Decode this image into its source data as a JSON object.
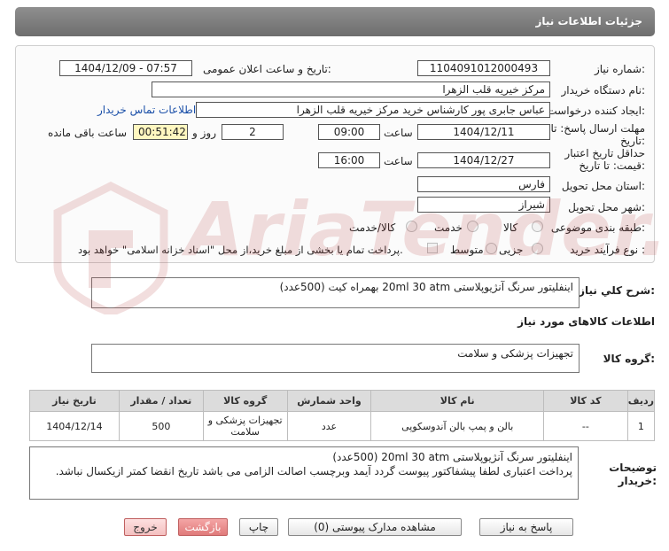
{
  "header": {
    "title": "جزئیات اطلاعات نیاز"
  },
  "form": {
    "need_number_label": "شماره نیاز:",
    "need_number": "1104091012000493",
    "announce_label": "تاریخ و ساعت اعلان عمومی:",
    "announce_value": "1404/12/09 - 07:57",
    "buyer_org_label": "نام دستگاه خریدار:",
    "buyer_org": "مرکز خیریه قلب الزهرا",
    "creator_label": "ایجاد کننده درخواست:",
    "creator": "عباس جابری پور کارشناس خرید مرکز خیریه قلب الزهرا",
    "contact_link": "اطلاعات تماس خریدار",
    "deadline_label_1": "مهلت ارسال پاسخ: تا",
    "deadline_label_2": "تاریخ:",
    "deadline_date": "1404/12/11",
    "time_label": "ساعت",
    "deadline_time": "09:00",
    "days_value": "2",
    "days_label": "روز و",
    "remaining_time": "00:51:42",
    "remaining_label": "ساعت باقی مانده",
    "validity_label_1": "حداقل تاریخ اعتبار",
    "validity_label_2": "قیمت: تا تاریخ:",
    "validity_date": "1404/12/27",
    "validity_time_label": "ساعت",
    "validity_time": "16:00",
    "province_label": "استان محل تحویل:",
    "province": "فارس",
    "city_label": "شهر محل تحویل:",
    "city": "شیراز",
    "category_label": "طبقه بندی موضوعی:",
    "category_options": [
      "کالا",
      "خدمت",
      "کالا/خدمت"
    ],
    "process_label": "نوع فرآیند خرید :",
    "process_options": [
      "جزیی",
      "متوسط"
    ],
    "payment_note": "پرداخت تمام یا بخشی از مبلغ خرید،از محل \"اسناد خزانه اسلامی\" خواهد بود."
  },
  "summary": {
    "label": "شرح كلي نياز:",
    "text": "اینفلیتور سرنگ آنژیوپلاستی 20ml 30 atm بهمراه کیت (500عدد)"
  },
  "goods": {
    "section_title": "اطلاعات کالاهای مورد نیاز",
    "group_label": "گروه کالا:",
    "group_value": "تجهیزات پزشکی و سلامت"
  },
  "table": {
    "headers": [
      "ردیف",
      "کد کالا",
      "نام کالا",
      "واحد شمارش",
      "گروه کالا",
      "تعداد / مقدار",
      "تاریخ نیاز"
    ],
    "rows": [
      {
        "row": "1",
        "code": "--",
        "name": "بالن و پمپ بالن آندوسکوپی",
        "unit": "عدد",
        "group": "تجهیزات پزشکی و سلامت",
        "qty": "500",
        "date": "1404/12/14"
      }
    ]
  },
  "buyer_notes": {
    "label": "توضیحات خریدار:",
    "line1": "اینفلیتور سرنگ آنژیوپلاستی 20ml 30 atm (500عدد)",
    "line2": "پرداخت اعتباری لطفا پیشفاکتور پیوست گردد آیمد وبرچسب اصالت الزامی می باشد تاریخ انقضا کمتر ازیکسال نباشد."
  },
  "buttons": {
    "reply": "پاسخ به نیاز",
    "attachments": "مشاهده مدارک پیوستی (0)",
    "print": "چاپ",
    "back": "بازگشت",
    "exit": "خروج"
  },
  "watermark": {
    "text": "AriaTender.neT"
  },
  "colors": {
    "header_bg": "#7f7f7f",
    "remaining_bg": "#fff7c0",
    "link": "#1a4fa8",
    "back_btn": "#e07a7a"
  }
}
